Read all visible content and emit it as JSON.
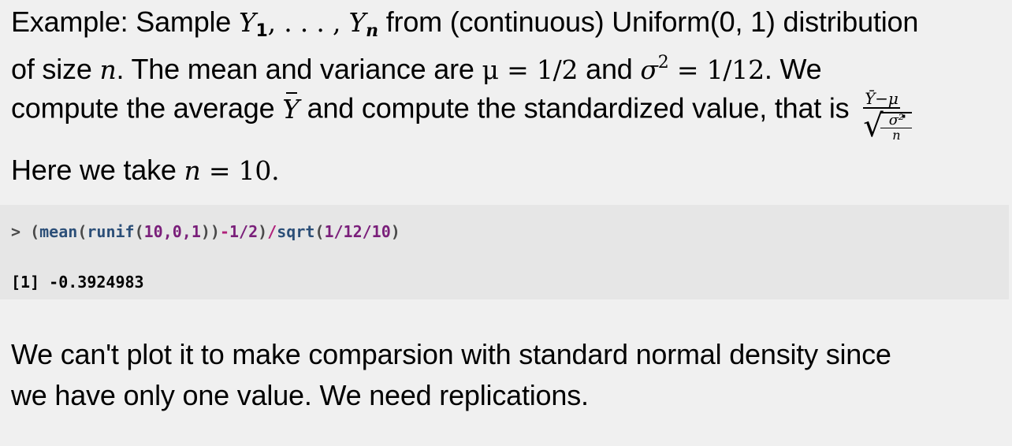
{
  "paragraph1": {
    "l1_a": "Example: Sample ",
    "l1_b": " from (continuous) Uniform(0, 1) distribution",
    "l2_a": "of size ",
    "l2_b": ". The mean and variance are ",
    "l2_c": " and ",
    "l2_d": ". We",
    "l3_a": "compute the average ",
    "l3_b": " and compute the standardized value, that is ",
    "l3_c": "."
  },
  "math": {
    "Y": "Y",
    "one": "1",
    "dots": ", . . . , ",
    "n": "n",
    "mu_eq": "μ = 1/2",
    "sigma": "σ",
    "two": "2",
    "sigma_eq": " = 1/12",
    "frac_num": "Ȳ−μ",
    "frac_sqrt_num": "σ²",
    "frac_sqrt_den": "n"
  },
  "paragraph2": {
    "a": "Here we take ",
    "b": " = 10."
  },
  "code": {
    "prompt": "> ",
    "open": "(",
    "mean": "mean",
    "p1": "(",
    "runif": "runif",
    "p2": "(",
    "args": "10,0,1",
    "close1": "))",
    "minus": "-",
    "half": "1/2",
    "close2": ")",
    "slash": "/",
    "sqrt": "sqrt",
    "p3": "(",
    "sqargs": "1/12/10",
    "close3": ")",
    "output": "[1] -0.3924983"
  },
  "paragraph3": {
    "l1": "We can't plot it to make comparsion with standard normal density since",
    "l2": "we have only one value. We need replications."
  }
}
